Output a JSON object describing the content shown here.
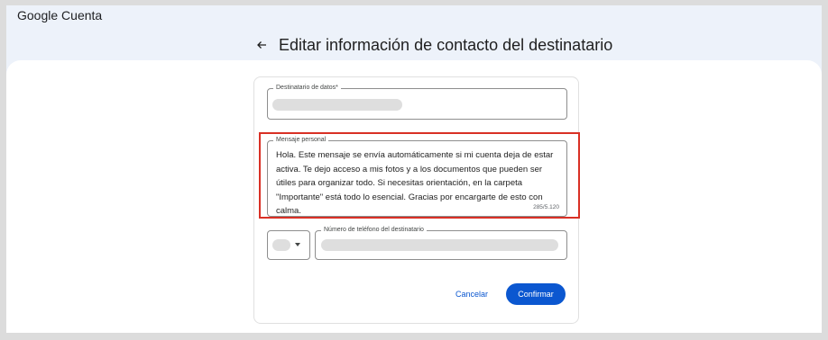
{
  "header": {
    "brand_google": "Google",
    "brand_product": "Cuenta"
  },
  "page": {
    "title": "Editar información de contacto del destinatario"
  },
  "form": {
    "recipient_field": {
      "label": "Destinatario de datos*"
    },
    "message_field": {
      "label": "Mensaje personal",
      "value": "Hola. Este mensaje se envía automáticamente si mi cuenta deja de estar activa. Te dejo acceso a mis fotos y a los documentos que pueden ser útiles para organizar todo. Si necesitas orientación, en la carpeta \"Importante\" está todo lo esencial. Gracias por encargarte de esto con calma.",
      "counter": "285/5.120"
    },
    "phone_field": {
      "label": "Número de teléfono del destinatario"
    },
    "actions": {
      "cancel_label": "Cancelar",
      "confirm_label": "Confirmar"
    }
  },
  "colors": {
    "accent": "#0b57d0",
    "highlight": "#d93025",
    "header_bg": "#edf2fa"
  },
  "icons": {
    "back": "arrow-left-icon",
    "dropdown": "caret-down-icon"
  }
}
